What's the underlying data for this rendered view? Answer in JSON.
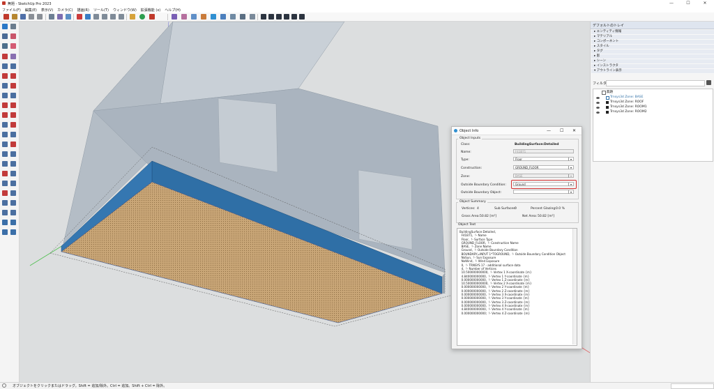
{
  "window": {
    "title": "無題 - SketchUp Pro 2023",
    "controls": [
      "—",
      "☐",
      "✕"
    ]
  },
  "menu": [
    "ファイル(F)",
    "編集(E)",
    "表示(V)",
    "カメラ(C)",
    "描画(R)",
    "ツール(T)",
    "ウィンドウ(W)",
    "拡張機能 (x)",
    "ヘルプ(H)"
  ],
  "tray": {
    "title": "デフォルトのトレイ",
    "panels": [
      "エンティティ情報",
      "マテリアル",
      "コンポーネント",
      "スタイル",
      "タグ",
      "影",
      "シーン",
      "インストラクタ",
      "アウトライン表示"
    ],
    "filter_label": "フィルタ",
    "outliner": {
      "root": "無題",
      "items": [
        "Trnsys3d Zone: BASE",
        "Trnsys3d Zone: ROOF",
        "Trnsys3d Zone: ROOM1",
        "Trnsys3d Zone: ROOM2"
      ]
    }
  },
  "dialog": {
    "title": "Object Info",
    "controls": [
      "—",
      "☐",
      "✕"
    ],
    "inputs_title": "Object Inputs",
    "class_label": "Class:",
    "class_value": "BuildingSurface:Detailed",
    "name_label": "Name:",
    "name_value": "F41B71",
    "type_label": "Type:",
    "type_value": "Floor",
    "construction_label": "Construction:",
    "construction_value": "GROUND_FLOOR",
    "zone_label": "Zone:",
    "zone_value": "BASE",
    "obc_label": "Outside Boundary Condition:",
    "obc_value": "Ground",
    "obco_label": "Outside Boundary Object:",
    "obco_value": "",
    "summary_title": "Object Summary",
    "vertices_label": "Vertices:",
    "vertices_value": "4",
    "sub_label": "Sub Surfaces:",
    "sub_value": "0",
    "glazing_label": "Percent Glazing:",
    "glazing_value": "0.0 %",
    "gross_label": "Gross Area:",
    "gross_value": "50.82 [m²]",
    "net_label": "Net Area:",
    "net_value": "50.82 [m²]",
    "text_title": "Object Text",
    "text_lines": [
      "BuildingSurface:Detailed,",
      "  F41B71,  !- Name",
      "  Floor,  !- Surface Type",
      "  GROUND_FLOOR,  !- Construction Name",
      "  BASE,  !- Zone Name",
      "  Ground,  !- Outside Boundary Condition",
      "  BOUNDARY=INPUT 1*TOGROUND,  !- Outside Boundary Condition Object",
      "  NoSun,  !- Sun Exposure",
      "  NoWind,  !- Wind Exposure",
      "  0,  !- TRNSYS 17 - additional surface data",
      "  4,  !- Number of Vertices",
      "  10.500000000000,  !- Vertex 1 X-coordinate {m}",
      "  4.840000000000,  !- Vertex 1 Y-coordinate {m}",
      "  0.000000000000,  !- Vertex 1 Z-coordinate {m}",
      "  10.500000000000,  !- Vertex 2 X-coordinate {m}",
      "  0.000000000000,  !- Vertex 2 Y-coordinate {m}",
      "  0.000000000000,  !- Vertex 2 Z-coordinate {m}",
      "  0.000000000000,  !- Vertex 3 X-coordinate {m}",
      "  0.000000000000,  !- Vertex 3 Y-coordinate {m}",
      "  0.000000000000,  !- Vertex 3 Z-coordinate {m}",
      "  0.000000000000,  !- Vertex 4 X-coordinate {m}",
      "  4.840000000000,  !- Vertex 4 Y-coordinate {m}",
      "  0.000000000000;  !- Vertex 4 Z-coordinate {m}"
    ]
  },
  "status": {
    "message": "オブジェクトをクリックまたはドラッグ。Shift = 追加/除外。Ctrl = 追加。Shift + Ctrl = 除外。"
  },
  "colors": {
    "accent_blue": "#2f6fa6",
    "floor_tan": "#c7a574",
    "highlight_red": "#d32f2f",
    "building_gray": "#a9b3bd"
  }
}
